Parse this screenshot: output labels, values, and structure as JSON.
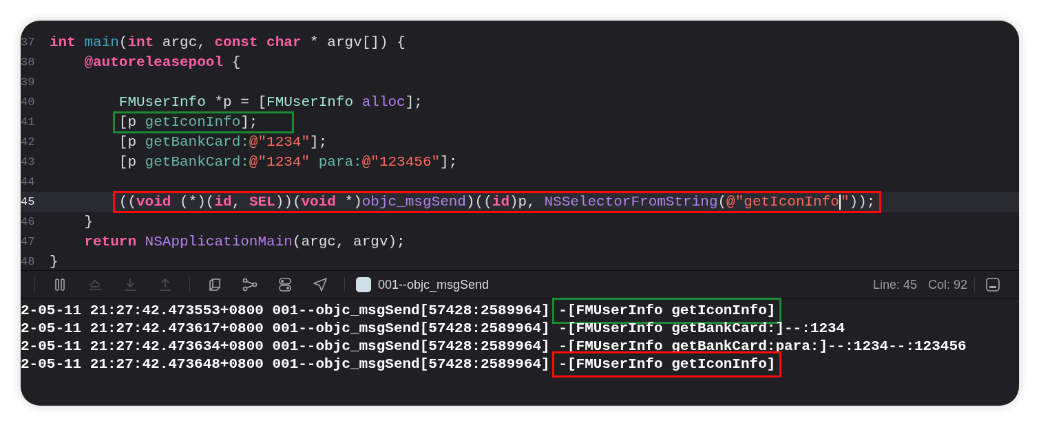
{
  "editor": {
    "lines": [
      {
        "number": "37",
        "current": false,
        "tokens": [
          {
            "kind": "keyword",
            "text": "int "
          },
          {
            "kind": "function",
            "text": "main"
          },
          {
            "kind": "plain",
            "text": "("
          },
          {
            "kind": "keyword",
            "text": "int"
          },
          {
            "kind": "plain",
            "text": " argc, "
          },
          {
            "kind": "keyword",
            "text": "const char"
          },
          {
            "kind": "plain",
            "text": " * argv[]) {"
          }
        ],
        "children": [
          {
            "number": "38",
            "current": false,
            "tokens": [
              {
                "kind": "keyword",
                "text": "@autoreleasepool"
              },
              {
                "kind": "plain",
                "text": " {"
              }
            ],
            "children": [
              {
                "number": "39",
                "current": false
              },
              {
                "number": "40",
                "current": false,
                "tokens": [
                  {
                    "kind": "class",
                    "text": "FMUserInfo"
                  },
                  {
                    "kind": "plain",
                    "text": " *p = ["
                  },
                  {
                    "kind": "class",
                    "text": "FMUserInfo "
                  },
                  {
                    "kind": "system",
                    "text": "alloc"
                  },
                  {
                    "kind": "plain",
                    "text": "];"
                  }
                ]
              },
              {
                "number": "41",
                "current": false,
                "tokens": [
                  {
                    "kind": "box",
                    "color": "#1a8a35",
                    "tokens": [
                      {
                        "kind": "plain",
                        "text": "[p "
                      },
                      {
                        "kind": "method",
                        "text": "getIconInfo"
                      },
                      {
                        "kind": "plain",
                        "text": "];"
                      }
                    ]
                  }
                ]
              },
              {
                "number": "42",
                "current": false,
                "tokens": [
                  {
                    "kind": "plain",
                    "text": "[p "
                  },
                  {
                    "kind": "method",
                    "text": "getBankCard:"
                  },
                  {
                    "kind": "string",
                    "text": "@\"1234\""
                  },
                  {
                    "kind": "plain",
                    "text": "];"
                  }
                ]
              },
              {
                "number": "43",
                "current": false,
                "tokens": [
                  {
                    "kind": "plain",
                    "text": "[p "
                  },
                  {
                    "kind": "method",
                    "text": "getBankCard:"
                  },
                  {
                    "kind": "string",
                    "text": "@\"1234\" "
                  },
                  {
                    "kind": "method",
                    "text": "para:"
                  },
                  {
                    "kind": "string",
                    "text": "@\"123456\""
                  },
                  {
                    "kind": "plain",
                    "text": "];"
                  }
                ]
              },
              {
                "number": "44",
                "current": false
              },
              {
                "number": "45",
                "current": true,
                "tokens": [
                  {
                    "kind": "box",
                    "color": "#ff0a0a",
                    "tokens": [
                      {
                        "kind": "plain",
                        "text": "(("
                      },
                      {
                        "kind": "keyword",
                        "text": "void"
                      },
                      {
                        "kind": "plain",
                        "text": " (*)("
                      },
                      {
                        "kind": "keyword",
                        "text": "id"
                      },
                      {
                        "kind": "plain",
                        "text": ", "
                      },
                      {
                        "kind": "keyword",
                        "text": "SEL"
                      },
                      {
                        "kind": "plain",
                        "text": "))("
                      },
                      {
                        "kind": "keyword",
                        "text": "void"
                      },
                      {
                        "kind": "plain",
                        "text": " *)"
                      },
                      {
                        "kind": "system",
                        "text": "objc_msgSend"
                      },
                      {
                        "kind": "plain",
                        "text": ")(("
                      },
                      {
                        "kind": "keyword",
                        "text": "id"
                      },
                      {
                        "kind": "plain",
                        "text": ")p, "
                      },
                      {
                        "kind": "system",
                        "text": "NSSelectorFromString"
                      },
                      {
                        "kind": "plain",
                        "text": "("
                      },
                      {
                        "kind": "string",
                        "text": "@\"getIconInfo"
                      },
                      {
                        "kind": "cursor"
                      },
                      {
                        "kind": "string",
                        "text": "\""
                      },
                      {
                        "kind": "plain",
                        "text": "));"
                      }
                    ]
                  }
                ]
              }
            ]
          },
          {
            "number": "46",
            "current": false,
            "tokens": [
              {
                "kind": "plain",
                "text": "}"
              }
            ]
          },
          {
            "number": "47",
            "current": false,
            "tokens": [
              {
                "kind": "keyword",
                "text": "return "
              },
              {
                "kind": "system",
                "text": "NSApplicationMain"
              },
              {
                "kind": "plain",
                "text": "(argc, argv);"
              }
            ]
          }
        ]
      },
      {
        "number": "48",
        "current": false,
        "tokens": [
          {
            "kind": "plain",
            "text": "}"
          }
        ]
      }
    ]
  },
  "debug_bar": {
    "buttons": [
      {
        "kind": "pause",
        "disabled": false
      },
      {
        "kind": "step-over",
        "disabled": true
      },
      {
        "kind": "step-into",
        "disabled": true
      },
      {
        "kind": "step-out",
        "disabled": true
      },
      {
        "kind": "view-debugger",
        "disabled": false
      },
      {
        "kind": "memory-graph",
        "disabled": false
      },
      {
        "kind": "environment",
        "disabled": false
      },
      {
        "kind": "location",
        "disabled": false
      }
    ],
    "target": "001--objc_msgSend",
    "line": "Line: 45",
    "column": "Col: 92"
  },
  "console": {
    "lines": [
      {
        "tokens": [
          {
            "kind": "text",
            "text": "2-05-11 21:27:42.473553+0800 001--objc_msgSend[57428:2589964] "
          },
          {
            "kind": "box",
            "color": "#1a8a35",
            "tokens": [
              {
                "kind": "text",
                "text": "-[FMUserInfo getIconInfo]"
              }
            ]
          }
        ]
      },
      {
        "tokens": [
          {
            "kind": "text",
            "text": "2-05-11 21:27:42.473617+0800 001--objc_msgSend[57428:2589964] -[FMUserInfo getBankCard:]--:1234"
          }
        ]
      },
      {
        "tokens": [
          {
            "kind": "text",
            "text": "2-05-11 21:27:42.473634+0800 001--objc_msgSend[57428:2589964] -[FMUserInfo getBankCard:para:]--:1234--:123456"
          }
        ]
      },
      {
        "tokens": [
          {
            "kind": "text",
            "text": "2-05-11 21:27:42.473648+0800 001--objc_msgSend[57428:2589964] "
          },
          {
            "kind": "box",
            "color": "#ff0a0a",
            "tokens": [
              {
                "kind": "text",
                "text": "-[FMUserInfo getIconInfo]"
              }
            ]
          }
        ]
      }
    ]
  }
}
